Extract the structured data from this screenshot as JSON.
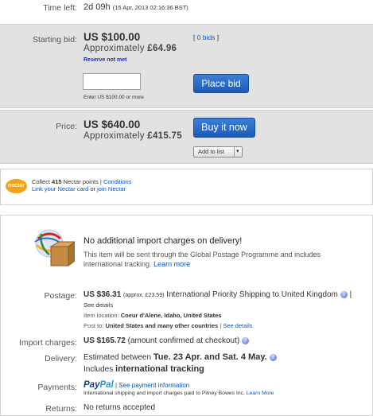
{
  "time_left": {
    "label": "Time left:",
    "value": "2d 09h",
    "detail": "(15 Apr, 2013  02:16:36 BST)"
  },
  "bid": {
    "label": "Starting bid:",
    "price": "US $100.00",
    "approx_prefix": "Approximately",
    "approx_value": "£64.96",
    "bids_link": "0 bids",
    "reserve": "Reserve not met",
    "input_value": "",
    "hint": "Enter US $100.00 or more",
    "button": "Place bid"
  },
  "buy": {
    "label": "Price:",
    "price": "US $640.00",
    "approx_prefix": "Approximately",
    "approx_value": "£415.75",
    "button": "Buy it now",
    "add_to_list": "Add to list"
  },
  "nectar": {
    "logo": "nectar",
    "collect_prefix": "Collect",
    "points": "415",
    "collect_suffix": "Nectar points |",
    "conditions": "Conditions",
    "link_card": "Link your Nectar card",
    "or": "or",
    "join": "join Nectar"
  },
  "shipping": {
    "heading": "No additional import charges on delivery!",
    "desc1": "This item will be sent through the Global Postage Programme and includes",
    "desc2": "international tracking.",
    "learn_more": "Learn more",
    "postage_label": "Postage:",
    "postage_price": "US $36.31",
    "postage_approx": "(approx. £23.59)",
    "postage_service": "International Priority Shipping to United Kingdom",
    "see_details": "See details",
    "item_location_label": "Item location:",
    "item_location": "Coeur d'Alene, Idaho, United States",
    "post_to_label": "Post to:",
    "post_to": "United States and many other countries",
    "see_details2": "See details",
    "import_label": "Import charges:",
    "import_value": "US $165.72",
    "import_note": "(amount confirmed at checkout)",
    "delivery_label": "Delivery:",
    "delivery_prefix": "Estimated between",
    "delivery_dates": "Tue. 23 Apr. and Sat. 4 May.",
    "includes": "Includes",
    "tracking": "international tracking",
    "payments_label": "Payments:",
    "paypal_a": "Pay",
    "paypal_b": "Pal",
    "payment_info": "See payment information",
    "payment_note": "International shipping and import charges paid to Pitney Bowes Inc.",
    "learn_more2": "Learn More",
    "returns_label": "Returns:",
    "returns_value": "No returns accepted"
  },
  "colors": {
    "link": "#0654ba",
    "button": "#1d5bb5",
    "panel": "#e2e2e2",
    "reserve": "#1a2ea8"
  }
}
